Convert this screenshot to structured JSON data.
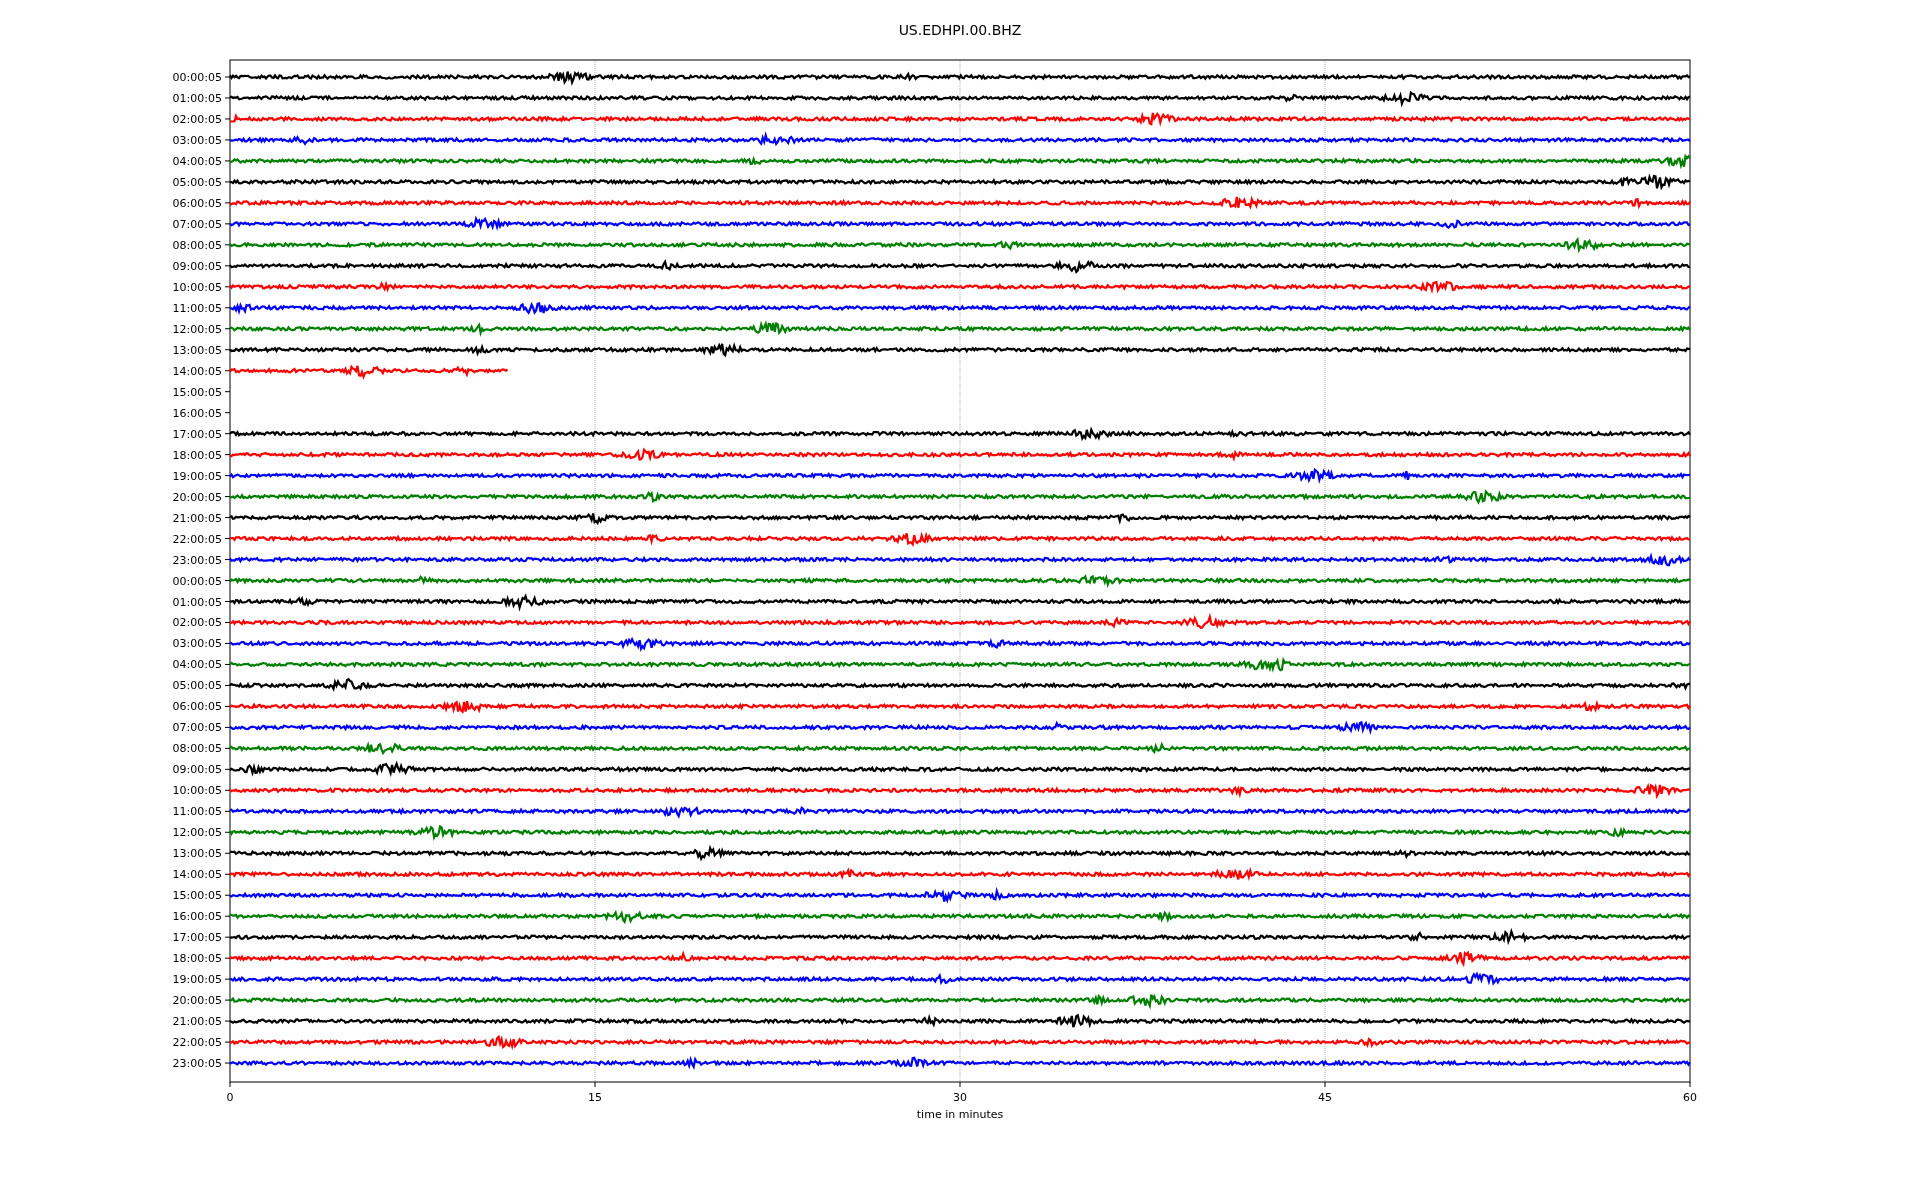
{
  "title": "US.EDHPI.00.BHZ",
  "rows": [
    {
      "label": "00:00:05",
      "color": "#000000",
      "level": 1
    },
    {
      "label": "01:00:05",
      "color": "#000000",
      "level": 1
    },
    {
      "label": "02:00:05",
      "color": "#ff0000",
      "level": 1
    },
    {
      "label": "03:00:05",
      "color": "#0000ff",
      "level": 1
    },
    {
      "label": "04:00:05",
      "color": "#008000",
      "level": 1
    },
    {
      "label": "05:00:05",
      "color": "#000000",
      "level": 1
    },
    {
      "label": "06:00:05",
      "color": "#ff0000",
      "level": 1
    },
    {
      "label": "07:00:05",
      "color": "#0000ff",
      "level": 1
    },
    {
      "label": "08:00:05",
      "color": "#008000",
      "level": 1
    },
    {
      "label": "09:00:05",
      "color": "#000000",
      "level": 1
    },
    {
      "label": "10:00:05",
      "color": "#ff0000",
      "level": 1
    },
    {
      "label": "11:00:05",
      "color": "#0000ff",
      "level": 1
    },
    {
      "label": "12:00:05",
      "color": "#008000",
      "level": 1
    },
    {
      "label": "13:00:05",
      "color": "#000000",
      "level": 1
    },
    {
      "label": "14:00:05",
      "color": "#ff0000",
      "level": 0.19
    },
    {
      "label": "15:00:05"
    },
    {
      "label": "16:00:05"
    },
    {
      "label": "17:00:05",
      "color": "#000000",
      "level": 1
    },
    {
      "label": "18:00:05",
      "color": "#ff0000",
      "level": 1
    },
    {
      "label": "19:00:05",
      "color": "#0000ff",
      "level": 1
    },
    {
      "label": "20:00:05",
      "color": "#008000",
      "level": 1
    },
    {
      "label": "21:00:05",
      "color": "#000000",
      "level": 1
    },
    {
      "label": "22:00:05",
      "color": "#ff0000",
      "level": 1
    },
    {
      "label": "23:00:05",
      "color": "#0000ff",
      "level": 1
    },
    {
      "label": "00:00:05",
      "color": "#008000",
      "level": 1
    },
    {
      "label": "01:00:05",
      "color": "#000000",
      "level": 1
    },
    {
      "label": "02:00:05",
      "color": "#ff0000",
      "level": 1
    },
    {
      "label": "03:00:05",
      "color": "#0000ff",
      "level": 1
    },
    {
      "label": "04:00:05",
      "color": "#008000",
      "level": 1
    },
    {
      "label": "05:00:05",
      "color": "#000000",
      "level": 1
    },
    {
      "label": "06:00:05",
      "color": "#ff0000",
      "level": 1
    },
    {
      "label": "07:00:05",
      "color": "#0000ff",
      "level": 1
    },
    {
      "label": "08:00:05",
      "color": "#008000",
      "level": 1
    },
    {
      "label": "09:00:05",
      "color": "#000000",
      "level": 1
    },
    {
      "label": "10:00:05",
      "color": "#ff0000",
      "level": 1
    },
    {
      "label": "11:00:05",
      "color": "#0000ff",
      "level": 1
    },
    {
      "label": "12:00:05",
      "color": "#008000",
      "level": 1
    },
    {
      "label": "13:00:05",
      "color": "#000000",
      "level": 1
    },
    {
      "label": "14:00:05",
      "color": "#ff0000",
      "level": 1
    },
    {
      "label": "15:00:05",
      "color": "#0000ff",
      "level": 1
    },
    {
      "label": "16:00:05",
      "color": "#008000",
      "level": 1
    },
    {
      "label": "17:00:05",
      "color": "#000000",
      "level": 1
    },
    {
      "label": "18:00:05",
      "color": "#ff0000",
      "level": 1
    },
    {
      "label": "19:00:05",
      "color": "#0000ff",
      "level": 1
    },
    {
      "label": "20:00:05",
      "color": "#008000",
      "level": 1
    },
    {
      "label": "21:00:05",
      "color": "#000000",
      "level": 1
    },
    {
      "label": "22:00:05",
      "color": "#ff0000",
      "level": 1
    },
    {
      "label": "23:00:05",
      "color": "#0000ff",
      "level": 1
    }
  ],
  "xticks": [
    "0",
    "15",
    "30",
    "45",
    "60"
  ],
  "xlabel": "time in minutes"
}
